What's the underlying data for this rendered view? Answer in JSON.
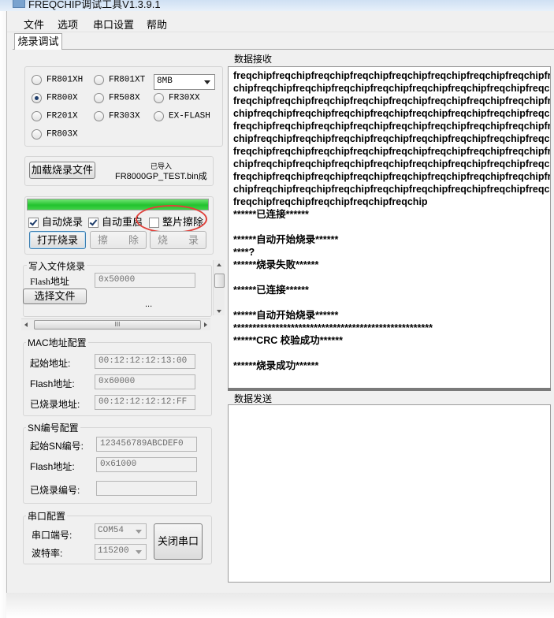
{
  "window": {
    "title": "FREQCHIP调试工具V1.3.9.1"
  },
  "menu": [
    "文件",
    "选项",
    "串口设置",
    "帮助"
  ],
  "tab": {
    "label": "烧录调试"
  },
  "chips": {
    "options": [
      "FR801XH",
      "FR801XT",
      "FR800X",
      "FR508X",
      "FR30XX",
      "FR201X",
      "FR303X",
      "EX-FLASH",
      "FR803X"
    ],
    "selected": "FR800X",
    "flash_size": "8MB"
  },
  "load": {
    "button": "加载烧录文件",
    "status": "已导入",
    "filename": "FR8000GP_TEST.bin成"
  },
  "burn": {
    "progress_percent": 100,
    "auto_burn": "自动烧录",
    "auto_burn_checked": true,
    "auto_restart": "自动重启",
    "auto_restart_checked": true,
    "chip_erase": "整片擦除",
    "chip_erase_checked": false,
    "open_button": "打开烧录",
    "erase_button": "擦　　除",
    "write_button": "烧　　录"
  },
  "write_file": {
    "title": "写入文件烧录",
    "flash_label": "Flash地址",
    "flash_value": "0x50000",
    "select_button": "选择文件",
    "ellipsis": "...",
    "hscroll_grip": "III"
  },
  "mac": {
    "title": "MAC地址配置",
    "start_label": "起始地址:",
    "start_value": "00:12:12:12:13:00",
    "flash_label": "Flash地址:",
    "flash_value": "0x60000",
    "burned_label": "已烧录地址:",
    "burned_value": "00:12:12:12:12:FF"
  },
  "sn": {
    "title": "SN编号配置",
    "start_label": "起始SN编号:",
    "start_value": "123456789ABCDEF0",
    "flash_label": "Flash地址:",
    "flash_value": "0x61000",
    "burned_label": "已烧录编号:",
    "burned_value": ""
  },
  "serial": {
    "title": "串口配置",
    "port_label": "串口端号:",
    "port_value": "COM54",
    "baud_label": "波特率:",
    "baud_value": "115200",
    "close_button": "关闭串口"
  },
  "receive": {
    "title": "数据接收",
    "lines": [
      "freqchipfreqchipfreqchipfreqchipfreqchipfreqchipfreqchipfreqchipfr",
      "chipfreqchipfreqchipfreqchipfreqchipfreqchipfreqchipfreqchipfreqcl",
      "freqchipfreqchipfreqchipfreqchipfreqchipfreqchipfreqchipfreqchipfr",
      "chipfreqchipfreqchipfreqchipfreqchipfreqchipfreqchipfreqchipfreqcl",
      "freqchipfreqchipfreqchipfreqchipfreqchipfreqchipfreqchipfreqchipfr",
      "chipfreqchipfreqchipfreqchipfreqchipfreqchipfreqchipfreqchipfreqcl",
      "freqchipfreqchipfreqchipfreqchipfreqchipfreqchipfreqchipfreqchipfr",
      "chipfreqchipfreqchipfreqchipfreqchipfreqchipfreqchipfreqchipfreqcl",
      "freqchipfreqchipfreqchipfreqchipfreqchipfreqchipfreqchipfreqchipfr",
      "chipfreqchipfreqchipfreqchipfreqchipfreqchipfreqchipfreqchipfreqcl",
      "freqchipfreqchipfreqchipfreqchipfreqchip",
      "******已连接******",
      "",
      "******自动开始烧录******",
      "****?",
      "******烧录失败******",
      "",
      "******已连接******",
      "",
      "******自动开始烧录******",
      "****************************************************",
      "******CRC 校验成功******",
      "",
      "******烧录成功******"
    ]
  },
  "send": {
    "title": "数据发送"
  },
  "colors": {
    "progress": "#22c32e",
    "annotation": "#e0403a",
    "accent": "#1e3d6b"
  }
}
